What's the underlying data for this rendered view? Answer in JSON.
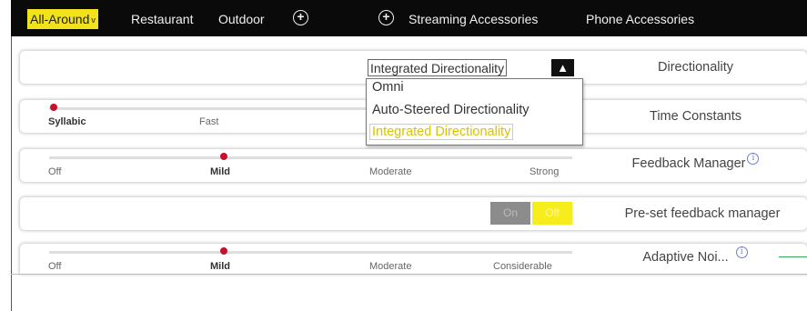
{
  "tabs": [
    {
      "label": "All-Around",
      "active": true,
      "chevron": "v"
    },
    {
      "label": "Restaurant"
    },
    {
      "label": "Outdoor"
    },
    {
      "label": "Streaming Accessories"
    },
    {
      "label": "Phone Accessories"
    }
  ],
  "icons": {
    "add": "plus-circle-icon",
    "info": "info-icon",
    "caret_up": "caret-up-icon"
  },
  "colors": {
    "accent": "#f2e21a",
    "knob": "#c8102e",
    "topbar": "#0a0a0a",
    "info": "#6b7fd0"
  },
  "directionality": {
    "label": "Directionality",
    "selected": "Integrated Directionality",
    "options": [
      "Omni",
      "Auto-Steered Directionality",
      "Integrated Directionality"
    ]
  },
  "time_constants": {
    "label": "Time Constants",
    "stops": [
      "Syllabic",
      "Fast"
    ],
    "selected": "Syllabic"
  },
  "feedback_manager": {
    "label": "Feedback Manager",
    "stops": [
      "Off",
      "Mild",
      "Moderate",
      "Strong"
    ],
    "selected": "Mild"
  },
  "preset_feedback": {
    "label": "Pre-set feedback manager",
    "on_label": "On",
    "off_label": "Off",
    "state": "Off"
  },
  "adaptive_noise": {
    "label": "Adaptive Noi...",
    "stops": [
      "Off",
      "Mild",
      "Moderate",
      "Considerable"
    ],
    "selected": "Mild"
  }
}
